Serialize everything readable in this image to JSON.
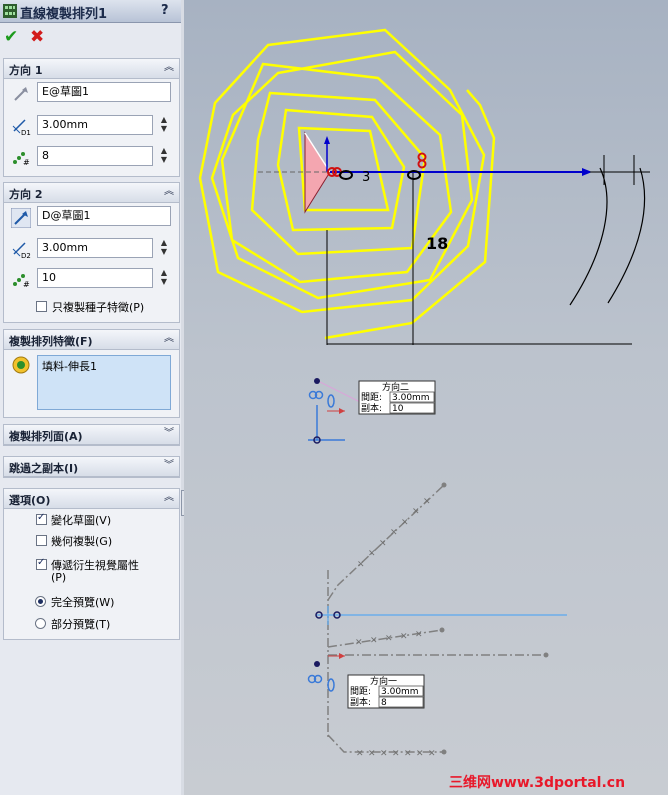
{
  "title_bar": {
    "title": "直線複製排列1",
    "help_label": "?"
  },
  "actions": {
    "ok_symbol": "✔",
    "cancel_symbol": "✖"
  },
  "direction1": {
    "header": "方向 1",
    "reference": "E@草圖1",
    "spacing": "3.00mm",
    "instances": "8",
    "spacing_icon_label": "D1",
    "instances_icon_label": "#"
  },
  "direction2": {
    "header": "方向 2",
    "reference": "D@草圖1",
    "spacing": "3.00mm",
    "instances": "10",
    "seed_only_label": "只複製種子特徵(P)",
    "seed_only_checked": false,
    "spacing_icon_label": "D2",
    "instances_icon_label": "#"
  },
  "features_to_pattern": {
    "header": "複製排列特徵(F)",
    "items": [
      "填料-伸長1"
    ]
  },
  "faces_to_pattern": {
    "header": "複製排列面(A)"
  },
  "instances_to_skip": {
    "header": "跳過之副本(I)"
  },
  "options": {
    "header": "選項(O)",
    "vary_sketch": {
      "label": "變化草圖(V)",
      "checked": true
    },
    "geometry_pattern": {
      "label": "幾何複製(G)",
      "checked": false
    },
    "propagate_visual_line1": "傳遞衍生視覺屬性",
    "propagate_visual_line2": "(P)",
    "propagate_visual_checked": true,
    "full_preview": {
      "label": "完全預覽(W)",
      "selected": true
    },
    "partial_preview": {
      "label": "部分預覽(T)",
      "selected": false
    }
  },
  "viewport": {
    "dimension_18": "18",
    "dimension_3": "3",
    "callout_dir2": {
      "title": "方向二",
      "spacing_label": "間距:",
      "spacing_value": "3.00mm",
      "count_label": "副本:",
      "count_value": "10"
    },
    "callout_dir1": {
      "title": "方向一",
      "spacing_label": "間距:",
      "spacing_value": "3.00mm",
      "count_label": "副本:",
      "count_value": "8"
    },
    "watermark": "三维网www.3dportal.cn",
    "colors": {
      "sketch": "#ffff00",
      "dimension": "#0000cc",
      "triangle": "#f4a6b0",
      "grey_pattern": "#808080"
    }
  }
}
